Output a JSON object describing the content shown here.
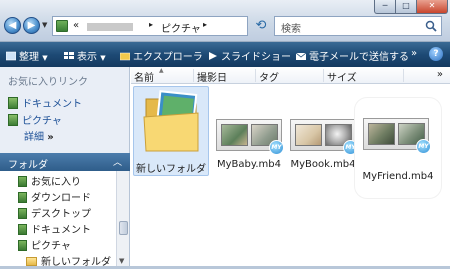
{
  "address": {
    "prefix": "«",
    "separator": "▸",
    "folder": "ピクチャ",
    "dropdown": "▾"
  },
  "search": {
    "placeholder": "検索"
  },
  "window": {
    "minimize": "─",
    "maximize": "□",
    "close": "✕"
  },
  "toolbar": {
    "organize": "整理",
    "views": "表示",
    "explorer": "エクスプローラ",
    "slideshow": "スライドショー",
    "email": "電子メールで送信する",
    "more": "»",
    "help": "?"
  },
  "nav": {
    "favorites_heading": "お気に入りリンク",
    "documents": "ドキュメント",
    "pictures": "ピクチャ",
    "details": "詳細",
    "details_chevron": "»",
    "folders_label": "フォルダ",
    "folders_chevron": "︿",
    "tree": [
      "お気に入り",
      "ダウンロード",
      "デスクトップ",
      "ドキュメント",
      "ピクチャ",
      "新しいフォルダ"
    ]
  },
  "columns": [
    "名前",
    "撮影日",
    "タグ",
    "サイズ"
  ],
  "columns_more": "»",
  "files": [
    {
      "label": "新しいフォルダ",
      "kind": "folder"
    },
    {
      "label": "MyBaby.mb4",
      "kind": "movie"
    },
    {
      "label": "MyBook.mb4",
      "kind": "movie"
    },
    {
      "label": "MyFriend.mb4",
      "kind": "movie"
    }
  ],
  "badge_text": "MY",
  "colors": {
    "toolbar": "#1d4a75",
    "selected_item": "#d9e8f9",
    "link": "#1b4f96"
  }
}
